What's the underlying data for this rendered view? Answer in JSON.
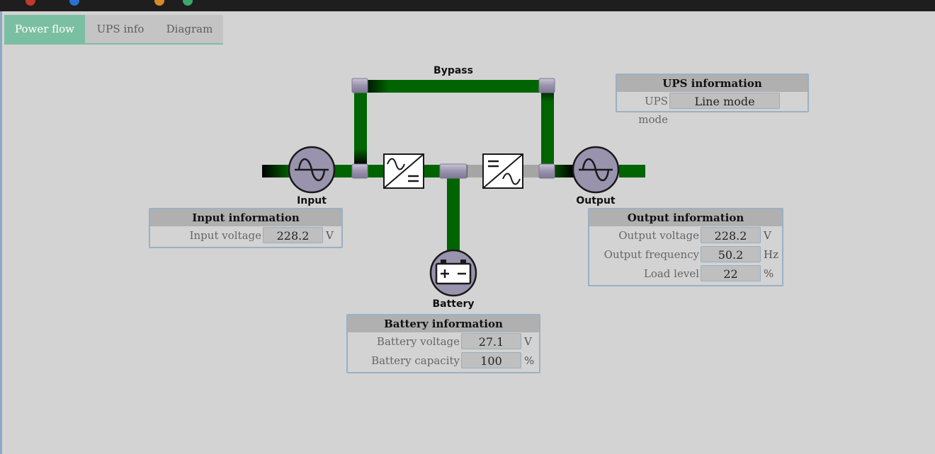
{
  "tabs": [
    {
      "label": "Power flow",
      "active": true
    },
    {
      "label": "UPS info",
      "active": false
    },
    {
      "label": "Diagram",
      "active": false
    }
  ],
  "diagram": {
    "bypass_label": "Bypass",
    "input_label": "Input",
    "output_label": "Output",
    "battery_label": "Battery",
    "colors": {
      "active_line": "#006400",
      "inactive_line": "#a5a5a5",
      "node": "#9a93ae"
    }
  },
  "ups_info": {
    "title": "UPS information",
    "mode_label": "UPS mode",
    "mode_value": "Line mode"
  },
  "input_info": {
    "title": "Input information",
    "voltage_label": "Input voltage",
    "voltage_value": "228.2",
    "voltage_unit": "V"
  },
  "output_info": {
    "title": "Output information",
    "voltage_label": "Output voltage",
    "voltage_value": "228.2",
    "voltage_unit": "V",
    "frequency_label": "Output frequency",
    "frequency_value": "50.2",
    "frequency_unit": "Hz",
    "load_label": "Load level",
    "load_value": "22",
    "load_unit": "%"
  },
  "battery_info": {
    "title": "Battery information",
    "voltage_label": "Battery voltage",
    "voltage_value": "27.1",
    "voltage_unit": "V",
    "capacity_label": "Battery capacity",
    "capacity_value": "100",
    "capacity_unit": "%"
  }
}
